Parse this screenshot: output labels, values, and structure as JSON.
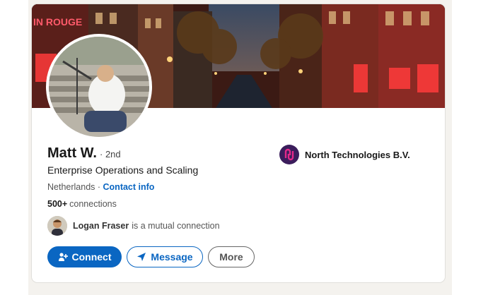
{
  "profile": {
    "name": "Matt W.",
    "degree": "· 2nd",
    "headline": "Enterprise Operations and Scaling",
    "location": "Netherlands",
    "location_separator": " · ",
    "contact_link": "Contact info",
    "connections_count": "500+",
    "connections_label": "connections",
    "mutual_name": "Logan Fraser",
    "mutual_suffix": "is a mutual connection"
  },
  "company": {
    "name": "North Technologies B.V."
  },
  "banner": {
    "sign_text": "IN ROUGE"
  },
  "actions": {
    "connect_label": "Connect",
    "message_label": "Message",
    "more_label": "More"
  },
  "colors": {
    "accent": "#0a66c2",
    "company_logo_bg": "#3b1d5c",
    "company_logo_fg": "#e4298a"
  },
  "icons": {
    "connect": "add-person-icon",
    "message": "send-icon",
    "company": "company-logo-icon"
  }
}
